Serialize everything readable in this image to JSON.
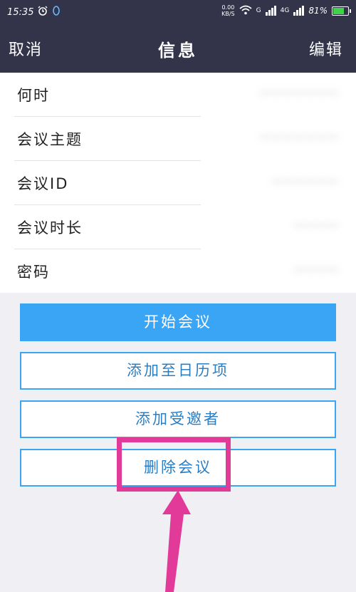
{
  "status": {
    "time": "15:35",
    "speed_top": "0.00",
    "speed_unit": "KB/S",
    "net1": "G",
    "net2": "4G",
    "battery": "81%",
    "battery_level": 0.81
  },
  "nav": {
    "left": "取消",
    "title": "信息",
    "right": "编辑"
  },
  "info_rows": [
    {
      "label": "何时",
      "value": "———————"
    },
    {
      "label": "会议主题",
      "value": "———————"
    },
    {
      "label": "会议ID",
      "value": "——————"
    },
    {
      "label": "会议时长",
      "value": "————"
    },
    {
      "label": "密码",
      "value": "————"
    }
  ],
  "buttons": {
    "start": "开始会议",
    "add_calendar": "添加至日历项",
    "add_invitee": "添加受邀者",
    "delete": "删除会议"
  },
  "colors": {
    "nav_bg": "#33334a",
    "primary": "#3aa4f5",
    "highlight": "#e23a99"
  }
}
